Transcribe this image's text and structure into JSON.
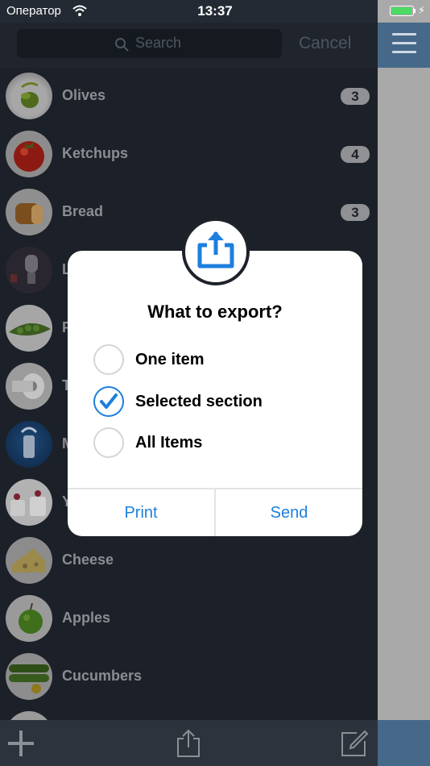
{
  "status_bar": {
    "carrier": "Оператор",
    "time": "13:37",
    "battery_fraction": 0.95
  },
  "search": {
    "placeholder": "Search",
    "cancel_label": "Cancel"
  },
  "list": {
    "items": [
      {
        "label": "Olives",
        "badge": "3",
        "icon": "olive-thumbnail"
      },
      {
        "label": "Ketchups",
        "badge": "4",
        "icon": "tomato-thumbnail"
      },
      {
        "label": "Bread",
        "badge": "3",
        "icon": "bread-thumbnail"
      },
      {
        "label": "L",
        "badge": "",
        "icon": "lightbulb-thumbnail"
      },
      {
        "label": "P",
        "badge": "",
        "icon": "peas-thumbnail"
      },
      {
        "label": "T",
        "badge": "",
        "icon": "toilet-paper-thumbnail"
      },
      {
        "label": "M",
        "badge": "",
        "icon": "milk-thumbnail"
      },
      {
        "label": "Y",
        "badge": "",
        "icon": "yogurt-thumbnail"
      },
      {
        "label": "Cheese",
        "badge": "",
        "icon": "cheese-thumbnail"
      },
      {
        "label": "Apples",
        "badge": "",
        "icon": "apple-thumbnail"
      },
      {
        "label": "Cucumbers",
        "badge": "",
        "icon": "cucumber-thumbnail"
      }
    ]
  },
  "dialog": {
    "title": "What to export?",
    "options": [
      {
        "label": "One item",
        "checked": false
      },
      {
        "label": "Selected section",
        "checked": true
      },
      {
        "label": "All Items",
        "checked": false
      }
    ],
    "print_label": "Print",
    "send_label": "Send"
  },
  "colors": {
    "accent": "#1d7fdd",
    "side_bar": "#46698a",
    "battery": "#4cd964"
  }
}
